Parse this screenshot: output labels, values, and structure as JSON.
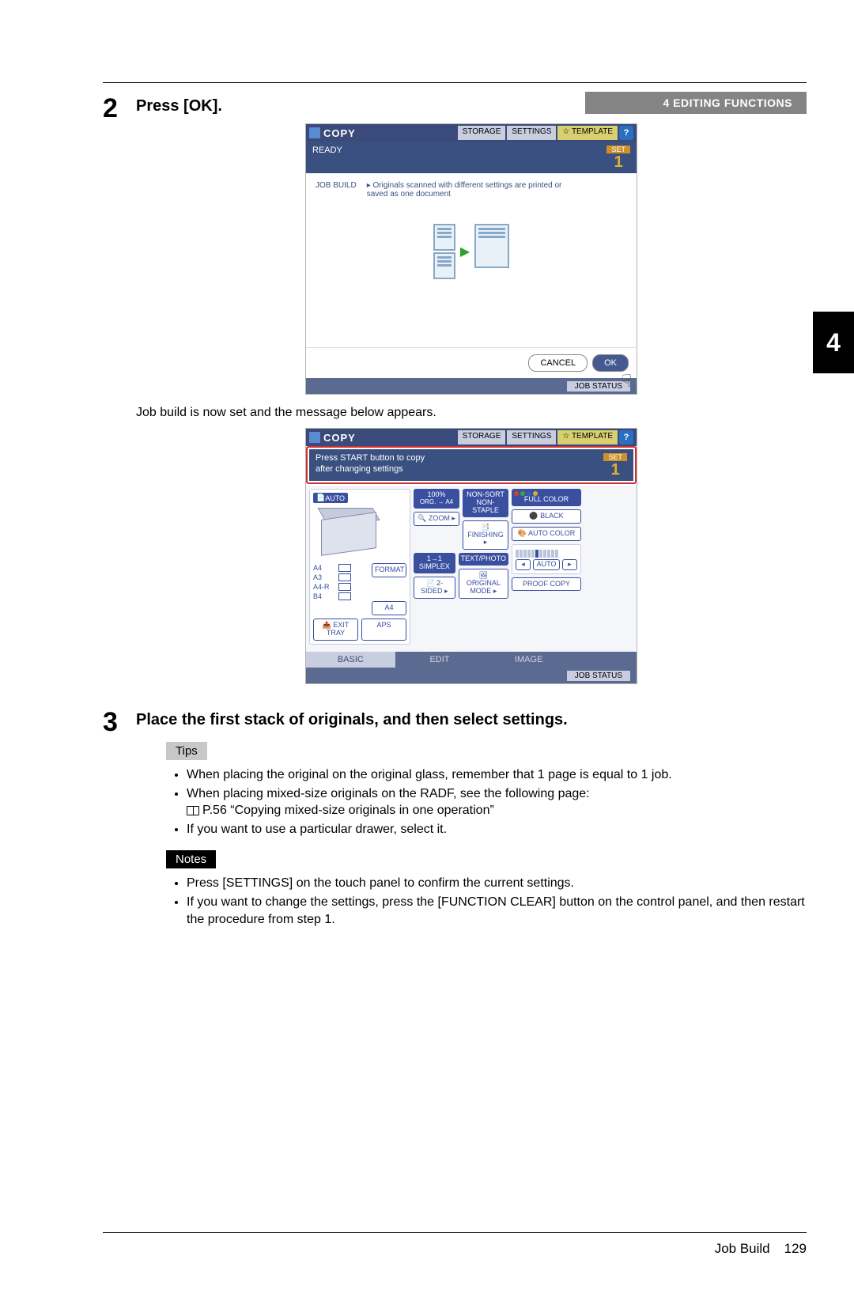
{
  "header": {
    "section": "4 EDITING FUNCTIONS"
  },
  "chapter_tab": "4",
  "step2": {
    "num": "2",
    "title": "Press [OK].",
    "between": "Job build is now set and the message below appears."
  },
  "step3": {
    "num": "3",
    "title": "Place the first stack of originals, and then select settings.",
    "tips_label": "Tips",
    "tips": [
      "When placing the original on the original glass, remember that 1 page is equal to 1 job.",
      "When placing mixed-size originals on the RADF, see the following page:",
      "If you want to use a particular drawer, select it."
    ],
    "tips_ref": "P.56 “Copying mixed-size originals in one operation”",
    "notes_label": "Notes",
    "notes": [
      "Press [SETTINGS] on the touch panel to confirm the current settings.",
      "If you want to change the settings, press the [FUNCTION CLEAR] button on the control panel, and then restart the procedure from step 1."
    ]
  },
  "screen1": {
    "copy": "COPY",
    "topbtns": {
      "storage": "STORAGE",
      "settings": "SETTINGS",
      "template": "TEMPLATE",
      "help": "?"
    },
    "status": "READY",
    "set_label": "SET",
    "set_num": "1",
    "job_build_lbl": "JOB BUILD",
    "job_build_desc": "▸ Originals scanned with different settings are printed or saved as one document",
    "cancel": "CANCEL",
    "ok": "OK",
    "jobstatus": "JOB STATUS"
  },
  "screen2": {
    "copy": "COPY",
    "topbtns": {
      "storage": "STORAGE",
      "settings": "SETTINGS",
      "template": "TEMPLATE",
      "help": "?"
    },
    "status_line1": "Press START button to copy",
    "status_line2": "after changing settings",
    "set_label": "SET",
    "set_num": "1",
    "auto": "AUTO",
    "format": "FORMAT",
    "papers": [
      "A4",
      "A3",
      "A4-R",
      "B4"
    ],
    "aps_row": "A4",
    "exit_tray": "EXIT TRAY",
    "aps": "APS",
    "zoom_pct": "100%",
    "zoom_range": "ORG. → A4",
    "zoom": "ZOOM",
    "nonsort": "NON-SORT NON-STAPLE",
    "finishing": "FINISHING",
    "simplex": "1→1 SIMPLEX",
    "twosided": "2-SIDED",
    "textphoto": "TEXT/PHOTO",
    "original_mode": "ORIGINAL MODE",
    "full_color": "FULL COLOR",
    "black": "BLACK",
    "auto_color": "AUTO COLOR",
    "auto_btn": "AUTO",
    "proof": "PROOF COPY",
    "tabs": {
      "basic": "BASIC",
      "edit": "EDIT",
      "image": "IMAGE"
    },
    "jobstatus": "JOB STATUS"
  },
  "footer": {
    "label": "Job Build",
    "page": "129"
  }
}
